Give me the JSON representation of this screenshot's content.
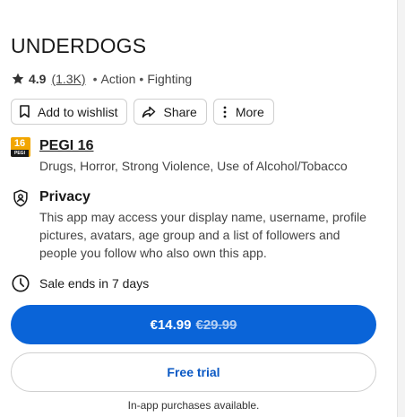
{
  "app": {
    "title": "UNDERDOGS",
    "rating": "4.9",
    "rating_count": "(1.3K)",
    "genres": [
      "Action",
      "Fighting"
    ],
    "separator": "•"
  },
  "actions": {
    "wishlist_label": "Add to wishlist",
    "share_label": "Share",
    "more_label": "More"
  },
  "pegi": {
    "badge_number": "16",
    "badge_text": "PEGI",
    "title": "PEGI 16",
    "descriptors": "Drugs, Horror, Strong Violence, Use of Alcohol/Tobacco"
  },
  "privacy": {
    "title": "Privacy",
    "lines": [
      "This app may access your display name, username, profile",
      "pictures, avatars, age group and a list of followers and",
      "people you follow who also own this app."
    ]
  },
  "sale": {
    "text": "Sale ends in 7 days"
  },
  "purchase": {
    "price": "€14.99",
    "original_price": "€29.99",
    "free_trial_label": "Free trial",
    "iap_note": "In-app purchases available."
  },
  "colors": {
    "primary": "#0a64d8",
    "trial_text": "#0a58c4",
    "pegi_badge": "#f2a600"
  },
  "icons": {
    "rating": "star-icon",
    "wishlist": "bookmark-icon",
    "share": "share-icon",
    "more": "more-vertical-icon",
    "privacy": "shield-person-icon",
    "sale": "clock-icon"
  }
}
